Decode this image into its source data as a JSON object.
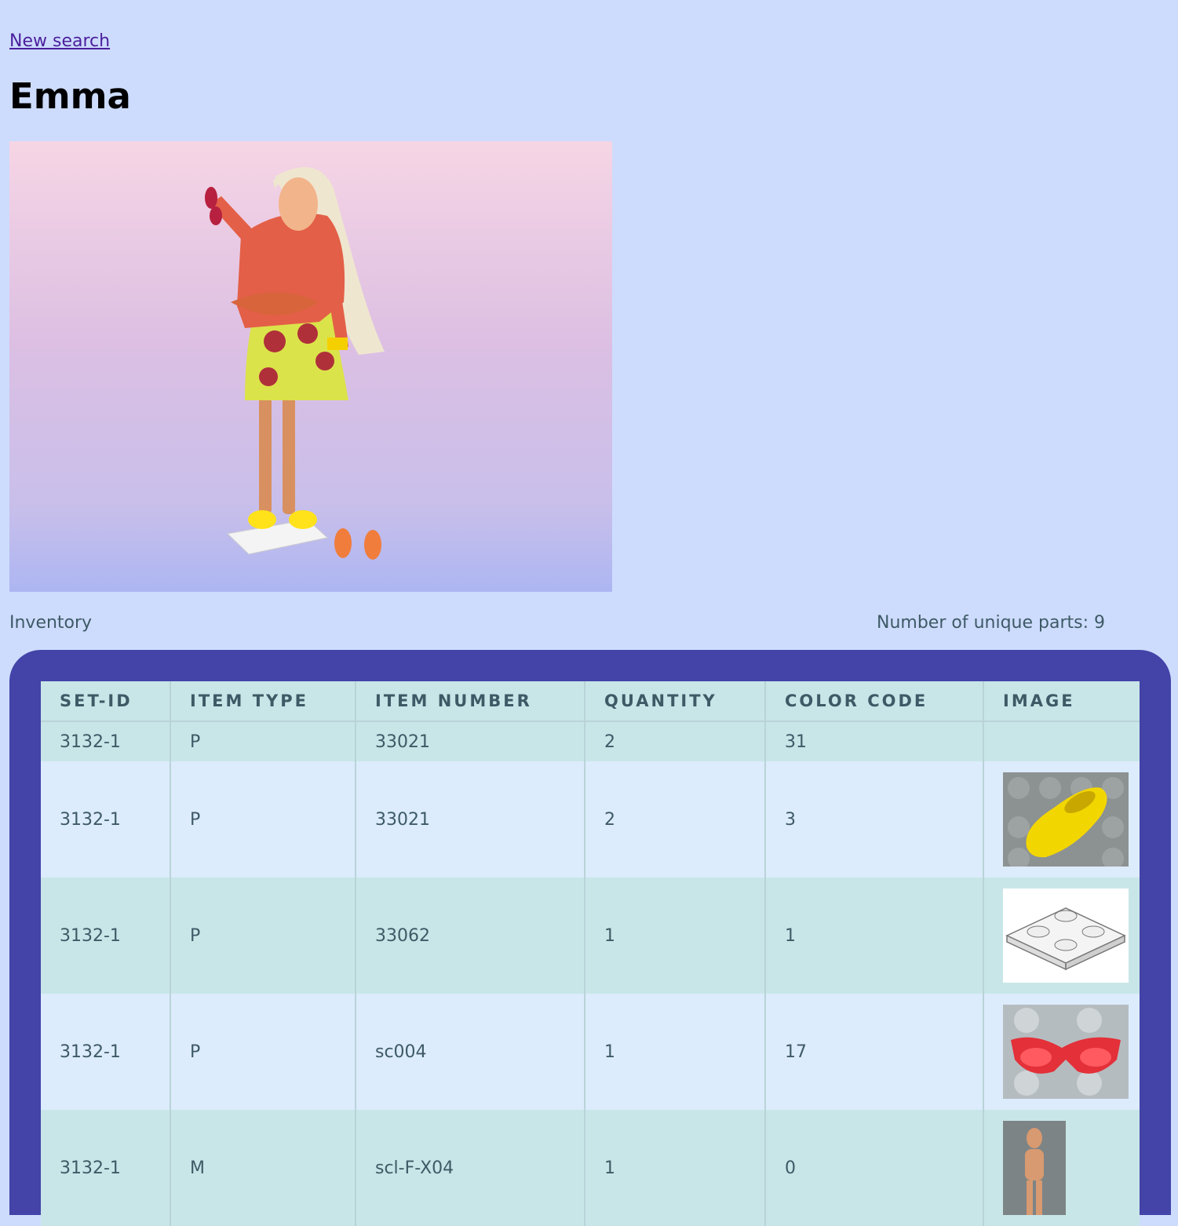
{
  "nav": {
    "new_search": "New search"
  },
  "set": {
    "name": "Emma"
  },
  "inventory": {
    "label": "Inventory",
    "unique_parts": "Number of unique parts: 9"
  },
  "table": {
    "headers": [
      "SET-ID",
      "ITEM TYPE",
      "ITEM NUMBER",
      "QUANTITY",
      "COLOR CODE",
      "IMAGE"
    ],
    "rows": [
      {
        "set_id": "3132-1",
        "item_type": "P",
        "item_number": "33021",
        "quantity": "2",
        "color_code": "31",
        "image": "none"
      },
      {
        "set_id": "3132-1",
        "item_type": "P",
        "item_number": "33021",
        "quantity": "2",
        "color_code": "3",
        "image": "yellow-shoe-part"
      },
      {
        "set_id": "3132-1",
        "item_type": "P",
        "item_number": "33062",
        "quantity": "1",
        "color_code": "1",
        "image": "white-plate-part"
      },
      {
        "set_id": "3132-1",
        "item_type": "P",
        "item_number": "sc004",
        "quantity": "1",
        "color_code": "17",
        "image": "red-sunglasses-part"
      },
      {
        "set_id": "3132-1",
        "item_type": "M",
        "item_number": "scl-F-X04",
        "quantity": "1",
        "color_code": "0",
        "image": "doll-figure"
      }
    ]
  }
}
